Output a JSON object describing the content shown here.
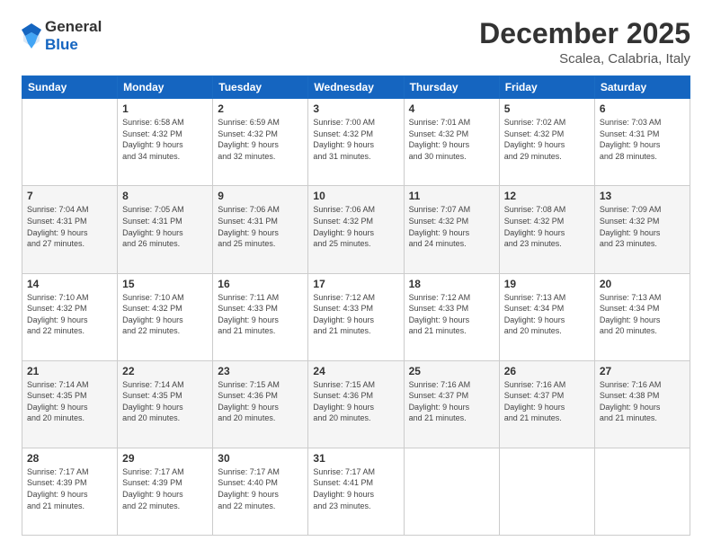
{
  "header": {
    "logo_general": "General",
    "logo_blue": "Blue",
    "month_title": "December 2025",
    "location": "Scalea, Calabria, Italy"
  },
  "days_of_week": [
    "Sunday",
    "Monday",
    "Tuesday",
    "Wednesday",
    "Thursday",
    "Friday",
    "Saturday"
  ],
  "weeks": [
    [
      {
        "day": "",
        "info": ""
      },
      {
        "day": "1",
        "info": "Sunrise: 6:58 AM\nSunset: 4:32 PM\nDaylight: 9 hours\nand 34 minutes."
      },
      {
        "day": "2",
        "info": "Sunrise: 6:59 AM\nSunset: 4:32 PM\nDaylight: 9 hours\nand 32 minutes."
      },
      {
        "day": "3",
        "info": "Sunrise: 7:00 AM\nSunset: 4:32 PM\nDaylight: 9 hours\nand 31 minutes."
      },
      {
        "day": "4",
        "info": "Sunrise: 7:01 AM\nSunset: 4:32 PM\nDaylight: 9 hours\nand 30 minutes."
      },
      {
        "day": "5",
        "info": "Sunrise: 7:02 AM\nSunset: 4:32 PM\nDaylight: 9 hours\nand 29 minutes."
      },
      {
        "day": "6",
        "info": "Sunrise: 7:03 AM\nSunset: 4:31 PM\nDaylight: 9 hours\nand 28 minutes."
      }
    ],
    [
      {
        "day": "7",
        "info": "Sunrise: 7:04 AM\nSunset: 4:31 PM\nDaylight: 9 hours\nand 27 minutes."
      },
      {
        "day": "8",
        "info": "Sunrise: 7:05 AM\nSunset: 4:31 PM\nDaylight: 9 hours\nand 26 minutes."
      },
      {
        "day": "9",
        "info": "Sunrise: 7:06 AM\nSunset: 4:31 PM\nDaylight: 9 hours\nand 25 minutes."
      },
      {
        "day": "10",
        "info": "Sunrise: 7:06 AM\nSunset: 4:32 PM\nDaylight: 9 hours\nand 25 minutes."
      },
      {
        "day": "11",
        "info": "Sunrise: 7:07 AM\nSunset: 4:32 PM\nDaylight: 9 hours\nand 24 minutes."
      },
      {
        "day": "12",
        "info": "Sunrise: 7:08 AM\nSunset: 4:32 PM\nDaylight: 9 hours\nand 23 minutes."
      },
      {
        "day": "13",
        "info": "Sunrise: 7:09 AM\nSunset: 4:32 PM\nDaylight: 9 hours\nand 23 minutes."
      }
    ],
    [
      {
        "day": "14",
        "info": "Sunrise: 7:10 AM\nSunset: 4:32 PM\nDaylight: 9 hours\nand 22 minutes."
      },
      {
        "day": "15",
        "info": "Sunrise: 7:10 AM\nSunset: 4:32 PM\nDaylight: 9 hours\nand 22 minutes."
      },
      {
        "day": "16",
        "info": "Sunrise: 7:11 AM\nSunset: 4:33 PM\nDaylight: 9 hours\nand 21 minutes."
      },
      {
        "day": "17",
        "info": "Sunrise: 7:12 AM\nSunset: 4:33 PM\nDaylight: 9 hours\nand 21 minutes."
      },
      {
        "day": "18",
        "info": "Sunrise: 7:12 AM\nSunset: 4:33 PM\nDaylight: 9 hours\nand 21 minutes."
      },
      {
        "day": "19",
        "info": "Sunrise: 7:13 AM\nSunset: 4:34 PM\nDaylight: 9 hours\nand 20 minutes."
      },
      {
        "day": "20",
        "info": "Sunrise: 7:13 AM\nSunset: 4:34 PM\nDaylight: 9 hours\nand 20 minutes."
      }
    ],
    [
      {
        "day": "21",
        "info": "Sunrise: 7:14 AM\nSunset: 4:35 PM\nDaylight: 9 hours\nand 20 minutes."
      },
      {
        "day": "22",
        "info": "Sunrise: 7:14 AM\nSunset: 4:35 PM\nDaylight: 9 hours\nand 20 minutes."
      },
      {
        "day": "23",
        "info": "Sunrise: 7:15 AM\nSunset: 4:36 PM\nDaylight: 9 hours\nand 20 minutes."
      },
      {
        "day": "24",
        "info": "Sunrise: 7:15 AM\nSunset: 4:36 PM\nDaylight: 9 hours\nand 20 minutes."
      },
      {
        "day": "25",
        "info": "Sunrise: 7:16 AM\nSunset: 4:37 PM\nDaylight: 9 hours\nand 21 minutes."
      },
      {
        "day": "26",
        "info": "Sunrise: 7:16 AM\nSunset: 4:37 PM\nDaylight: 9 hours\nand 21 minutes."
      },
      {
        "day": "27",
        "info": "Sunrise: 7:16 AM\nSunset: 4:38 PM\nDaylight: 9 hours\nand 21 minutes."
      }
    ],
    [
      {
        "day": "28",
        "info": "Sunrise: 7:17 AM\nSunset: 4:39 PM\nDaylight: 9 hours\nand 21 minutes."
      },
      {
        "day": "29",
        "info": "Sunrise: 7:17 AM\nSunset: 4:39 PM\nDaylight: 9 hours\nand 22 minutes."
      },
      {
        "day": "30",
        "info": "Sunrise: 7:17 AM\nSunset: 4:40 PM\nDaylight: 9 hours\nand 22 minutes."
      },
      {
        "day": "31",
        "info": "Sunrise: 7:17 AM\nSunset: 4:41 PM\nDaylight: 9 hours\nand 23 minutes."
      },
      {
        "day": "",
        "info": ""
      },
      {
        "day": "",
        "info": ""
      },
      {
        "day": "",
        "info": ""
      }
    ]
  ]
}
